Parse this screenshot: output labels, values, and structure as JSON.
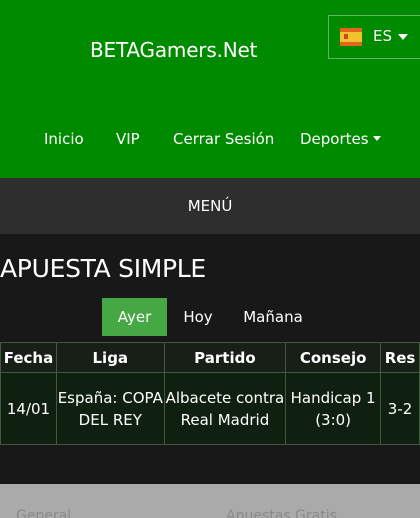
{
  "header": {
    "site_title": "BETAGamers.Net",
    "language": {
      "code": "ES",
      "flag": "spain-flag-icon"
    },
    "nav": [
      {
        "label": "Inicio"
      },
      {
        "label": "VIP"
      },
      {
        "label": "Cerrar Sesión"
      },
      {
        "label": "Deportes",
        "has_dropdown": true
      }
    ],
    "accent_color": "#008a00"
  },
  "menu_label": "MENÚ",
  "main": {
    "title": "APUESTA SIMPLE",
    "tabs": [
      {
        "label": "Ayer",
        "active": true
      },
      {
        "label": "Hoy",
        "active": false
      },
      {
        "label": "Mañana",
        "active": false
      }
    ],
    "table": {
      "headers": [
        "Fecha",
        "Liga",
        "Partido",
        "Consejo",
        "Res"
      ],
      "rows": [
        [
          "14/01",
          "España: COPA DEL REY",
          "Albacete contra Real Madrid",
          "Handicap 1 (3:0)",
          "3-2"
        ]
      ]
    }
  },
  "footer": {
    "links": [
      "General",
      "Apuestas Gratis"
    ]
  }
}
